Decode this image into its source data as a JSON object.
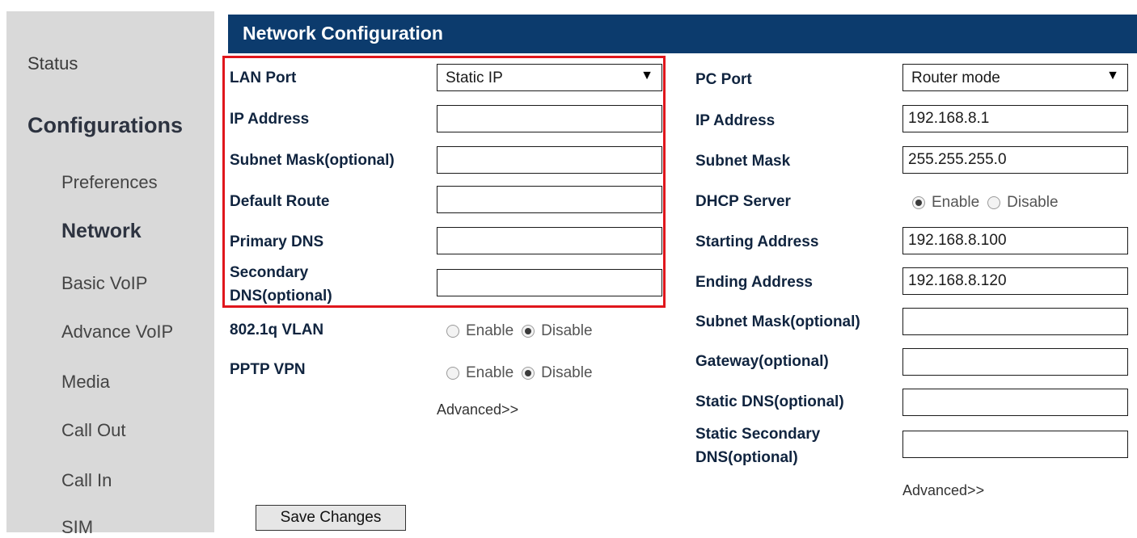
{
  "sidebar": {
    "status": "Status",
    "configurations": "Configurations",
    "items": [
      {
        "label": "Preferences"
      },
      {
        "label": "Network"
      },
      {
        "label": "Basic VoIP"
      },
      {
        "label": "Advance VoIP"
      },
      {
        "label": "Media"
      },
      {
        "label": "Call Out"
      },
      {
        "label": "Call In"
      },
      {
        "label": "SIM"
      }
    ],
    "active_item": "Network"
  },
  "header": {
    "title": "Network Configuration"
  },
  "lan": {
    "port_label": "LAN Port",
    "port_value": "Static IP",
    "ip_label": "IP Address",
    "ip_value": "",
    "subnet_label": "Subnet Mask(optional)",
    "subnet_value": "",
    "route_label": "Default Route",
    "route_value": "",
    "dns1_label": "Primary DNS",
    "dns1_value": "",
    "dns2_label_line1": "Secondary",
    "dns2_label_line2": "DNS(optional)",
    "dns2_value": "",
    "vlan_label": "802.1q VLAN",
    "vlan_enable": "Enable",
    "vlan_disable": "Disable",
    "vlan_selected": "Disable",
    "pptp_label": "PPTP VPN",
    "pptp_enable": "Enable",
    "pptp_disable": "Disable",
    "pptp_selected": "Disable",
    "advanced": "Advanced>>"
  },
  "pc": {
    "port_label": "PC Port",
    "port_value": "Router mode",
    "ip_label": "IP Address",
    "ip_value": "192.168.8.1",
    "subnet_label": "Subnet Mask",
    "subnet_value": "255.255.255.0",
    "dhcp_label": "DHCP Server",
    "dhcp_enable": "Enable",
    "dhcp_disable": "Disable",
    "dhcp_selected": "Enable",
    "start_label": "Starting Address",
    "start_value": "192.168.8.100",
    "end_label": "Ending Address",
    "end_value": "192.168.8.120",
    "subnet_opt_label": "Subnet Mask(optional)",
    "subnet_opt_value": "",
    "gateway_label": "Gateway(optional)",
    "gateway_value": "",
    "sdns_label": "Static DNS(optional)",
    "sdns_value": "",
    "ssdns_label_line1": "Static Secondary",
    "ssdns_label_line2": "DNS(optional)",
    "ssdns_value": "",
    "advanced": "Advanced>>"
  },
  "actions": {
    "save": "Save Changes"
  },
  "colors": {
    "header_bg": "#0c3b6d",
    "sidebar_bg": "#d9d9d9",
    "highlight": "#e0161c"
  }
}
